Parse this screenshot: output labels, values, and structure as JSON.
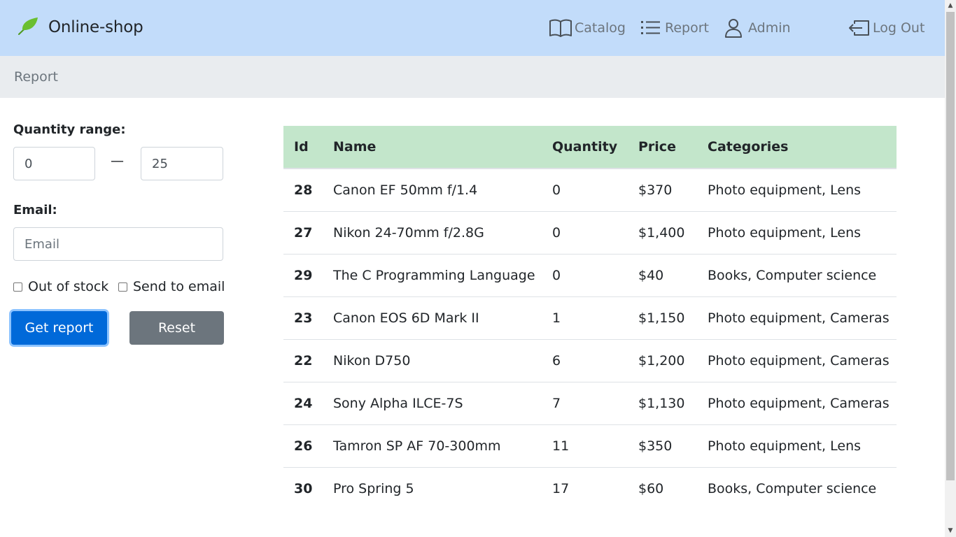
{
  "navbar": {
    "brand": "Online-shop",
    "links": [
      {
        "label": "Catalog",
        "icon": "book-icon"
      },
      {
        "label": "Report",
        "icon": "list-icon"
      },
      {
        "label": "Admin",
        "icon": "user-icon"
      },
      {
        "label": "Log Out",
        "icon": "logout-icon"
      }
    ]
  },
  "breadcrumb": "Report",
  "form": {
    "quantity_label": "Quantity range:",
    "min_value": "0",
    "dash": "—",
    "max_value": "25",
    "email_label": "Email:",
    "email_placeholder": "Email",
    "out_of_stock_label": "Out of stock",
    "send_to_email_label": "Send to email",
    "get_report_label": "Get report",
    "reset_label": "Reset"
  },
  "table": {
    "headers": [
      "Id",
      "Name",
      "Quantity",
      "Price",
      "Categories"
    ],
    "rows": [
      {
        "id": "28",
        "name": "Canon EF 50mm f/1.4",
        "quantity": "0",
        "price": "$370",
        "categories": "Photo equipment, Lens"
      },
      {
        "id": "27",
        "name": "Nikon 24-70mm f/2.8G",
        "quantity": "0",
        "price": "$1,400",
        "categories": "Photo equipment, Lens"
      },
      {
        "id": "29",
        "name": "The C Programming Language",
        "quantity": "0",
        "price": "$40",
        "categories": "Books, Computer science"
      },
      {
        "id": "23",
        "name": "Canon EOS 6D Mark II",
        "quantity": "1",
        "price": "$1,150",
        "categories": "Photo equipment, Cameras"
      },
      {
        "id": "22",
        "name": "Nikon D750",
        "quantity": "6",
        "price": "$1,200",
        "categories": "Photo equipment, Cameras"
      },
      {
        "id": "24",
        "name": "Sony Alpha ILCE-7S",
        "quantity": "7",
        "price": "$1,130",
        "categories": "Photo equipment, Cameras"
      },
      {
        "id": "26",
        "name": "Tamron SP AF 70-300mm",
        "quantity": "11",
        "price": "$350",
        "categories": "Photo equipment, Lens"
      },
      {
        "id": "30",
        "name": "Pro Spring 5",
        "quantity": "17",
        "price": "$60",
        "categories": "Books, Computer science"
      }
    ]
  },
  "colors": {
    "navbar_bg": "#c2dcfa",
    "breadcrumb_bg": "#e9ecef",
    "table_header_bg": "#c3e6cb",
    "primary": "#0069d9",
    "secondary": "#6c757d",
    "leaf": "#6abf30"
  }
}
